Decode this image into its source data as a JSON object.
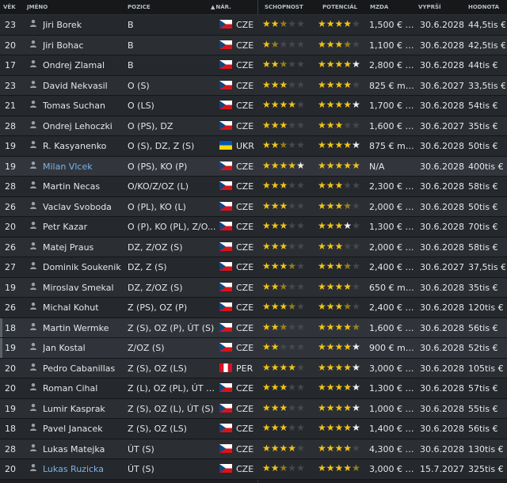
{
  "headers": {
    "age": "VĚK",
    "name": "JMÉNO",
    "position": "POZICE",
    "nationality": "NÁR.",
    "ability": "SCHOPNOST",
    "potential": "POTENCIÁL",
    "wage": "MZDA",
    "expires": "VYPRŠÍ",
    "value": "HODNOTA"
  },
  "colors": {
    "gold_star": "#f0c419",
    "white_star": "#f2f2f2",
    "link": "#7db2e8"
  },
  "players": [
    {
      "age": "23",
      "name": "Jiri Borek",
      "position": "B",
      "nat": "CZE",
      "flag": "cze",
      "ability": "2.5",
      "potential": "4",
      "wage": "1,500 € m...",
      "expires": "30.6.2028",
      "value": "44,5tis €"
    },
    {
      "age": "20",
      "name": "Jiri Bohac",
      "position": "B",
      "nat": "CZE",
      "flag": "cze",
      "ability": "1.5",
      "potential": "3.5",
      "wage": "1,100 € m...",
      "expires": "30.6.2028",
      "value": "42,5tis €"
    },
    {
      "age": "17",
      "name": "Ondrej Zlamal",
      "position": "B",
      "nat": "CZE",
      "flag": "cze",
      "ability": "2.5",
      "potential": "4w",
      "wage": "2,800 € m...",
      "expires": "30.6.2028",
      "value": "44tis €"
    },
    {
      "age": "23",
      "name": "David Nekvasil",
      "position": "O (S)",
      "nat": "CZE",
      "flag": "cze",
      "ability": "3",
      "potential": "4",
      "wage": "825 € měs.",
      "expires": "30.6.2027",
      "value": "33,5tis €"
    },
    {
      "age": "21",
      "name": "Tomas Suchan",
      "position": "O (LS)",
      "nat": "CZE",
      "flag": "cze",
      "ability": "4",
      "potential": "4w",
      "wage": "1,700 € m...",
      "expires": "30.6.2028",
      "value": "54tis €"
    },
    {
      "age": "28",
      "name": "Ondrej Lehoczki",
      "position": "O (PS), DZ",
      "nat": "CZE",
      "flag": "cze",
      "ability": "3",
      "potential": "3",
      "wage": "1,600 € m...",
      "expires": "30.6.2027",
      "value": "35tis €"
    },
    {
      "age": "19",
      "name": "R. Kasyanenko",
      "position": "O (S), DZ, Z (S)",
      "nat": "UKR",
      "flag": "ukr",
      "ability": "2.5",
      "potential": "4w",
      "wage": "875 € měs.",
      "expires": "30.6.2028",
      "value": "50tis €"
    },
    {
      "age": "19",
      "name": "Milan Vlcek",
      "position": "O (PS), KO (P)",
      "nat": "CZE",
      "flag": "cze",
      "ability": "4w",
      "potential": "5",
      "wage": "N/A",
      "expires": "30.6.2028",
      "value": "400tis €",
      "link": true,
      "selected": true
    },
    {
      "age": "28",
      "name": "Martin Necas",
      "position": "O/KO/Z/OZ (L)",
      "nat": "CZE",
      "flag": "cze",
      "ability": "3",
      "potential": "3",
      "wage": "2,300 € m...",
      "expires": "30.6.2028",
      "value": "58tis €"
    },
    {
      "age": "26",
      "name": "Vaclav Svoboda",
      "position": "O (PL), KO (L)",
      "nat": "CZE",
      "flag": "cze",
      "ability": "3",
      "potential": "3.5",
      "wage": "2,000 € m...",
      "expires": "30.6.2028",
      "value": "50tis €"
    },
    {
      "age": "20",
      "name": "Petr Kazar",
      "position": "O (P), KO (PL), Z/O...",
      "nat": "CZE",
      "flag": "cze",
      "ability": "3",
      "potential": "3w",
      "wage": "1,300 € m...",
      "expires": "30.6.2028",
      "value": "70tis €"
    },
    {
      "age": "26",
      "name": "Matej Praus",
      "position": "DZ, Z/OZ (S)",
      "nat": "CZE",
      "flag": "cze",
      "ability": "3",
      "potential": "3",
      "wage": "2,000 € m...",
      "expires": "30.6.2028",
      "value": "58tis €"
    },
    {
      "age": "27",
      "name": "Dominik Soukenik",
      "position": "DZ, Z (S)",
      "nat": "CZE",
      "flag": "cze",
      "ability": "3.5",
      "potential": "3.5",
      "wage": "2,400 € m...",
      "expires": "30.6.2027",
      "value": "37,5tis €"
    },
    {
      "age": "19",
      "name": "Miroslav Smekal",
      "position": "DZ, Z/OZ (S)",
      "nat": "CZE",
      "flag": "cze",
      "ability": "2.5",
      "potential": "4",
      "wage": "650 € měs.",
      "expires": "30.6.2028",
      "value": "35tis €"
    },
    {
      "age": "26",
      "name": "Michal Kohut",
      "position": "Z (PS), OZ (P)",
      "nat": "CZE",
      "flag": "cze",
      "ability": "3.5",
      "potential": "3.5",
      "wage": "2,400 € m...",
      "expires": "30.6.2028",
      "value": "120tis €"
    },
    {
      "age": "18",
      "name": "Martin Wermke",
      "position": "Z (S), OZ (P), ÚT (S)",
      "nat": "CZE",
      "flag": "cze",
      "ability": "2.5",
      "potential": "4.5",
      "wage": "1,600 € m...",
      "expires": "30.6.2028",
      "value": "56tis €",
      "highlight": true
    },
    {
      "age": "19",
      "name": "Jan Kostal",
      "position": "Z/OZ (S)",
      "nat": "CZE",
      "flag": "cze",
      "ability": "2",
      "potential": "4w",
      "wage": "900 € měs.",
      "expires": "30.6.2028",
      "value": "52tis €",
      "highlight": true
    },
    {
      "age": "20",
      "name": "Pedro Cabanillas",
      "position": "Z (S), OZ (LS)",
      "nat": "PER",
      "flag": "per",
      "ability": "4",
      "potential": "4w",
      "wage": "3,000 € m...",
      "expires": "30.6.2028",
      "value": "105tis €"
    },
    {
      "age": "20",
      "name": "Roman Cihal",
      "position": "Z (L), OZ (PL), ÚT (S)",
      "nat": "CZE",
      "flag": "cze",
      "ability": "3",
      "potential": "4w",
      "wage": "1,300 € m...",
      "expires": "30.6.2028",
      "value": "57tis €"
    },
    {
      "age": "19",
      "name": "Lumir Kasprak",
      "position": "Z (S), OZ (L), ÚT (S)",
      "nat": "CZE",
      "flag": "cze",
      "ability": "3",
      "potential": "4w",
      "wage": "1,000 € m...",
      "expires": "30.6.2028",
      "value": "55tis €"
    },
    {
      "age": "18",
      "name": "Pavel Janacek",
      "position": "Z (S), OZ (LS)",
      "nat": "CZE",
      "flag": "cze",
      "ability": "3",
      "potential": "4w",
      "wage": "1,400 € m...",
      "expires": "30.6.2028",
      "value": "56tis €"
    },
    {
      "age": "28",
      "name": "Lukas Matejka",
      "position": "ÚT (S)",
      "nat": "CZE",
      "flag": "cze",
      "ability": "4",
      "potential": "4",
      "wage": "4,300 € m...",
      "expires": "30.6.2028",
      "value": "130tis €"
    },
    {
      "age": "20",
      "name": "Lukas Ruzicka",
      "position": "ÚT (S)",
      "nat": "CZE",
      "flag": "cze",
      "ability": "2.5",
      "potential": "4.5",
      "wage": "3,000 € m...",
      "expires": "15.7.2027",
      "value": "325tis €",
      "link": true
    }
  ]
}
